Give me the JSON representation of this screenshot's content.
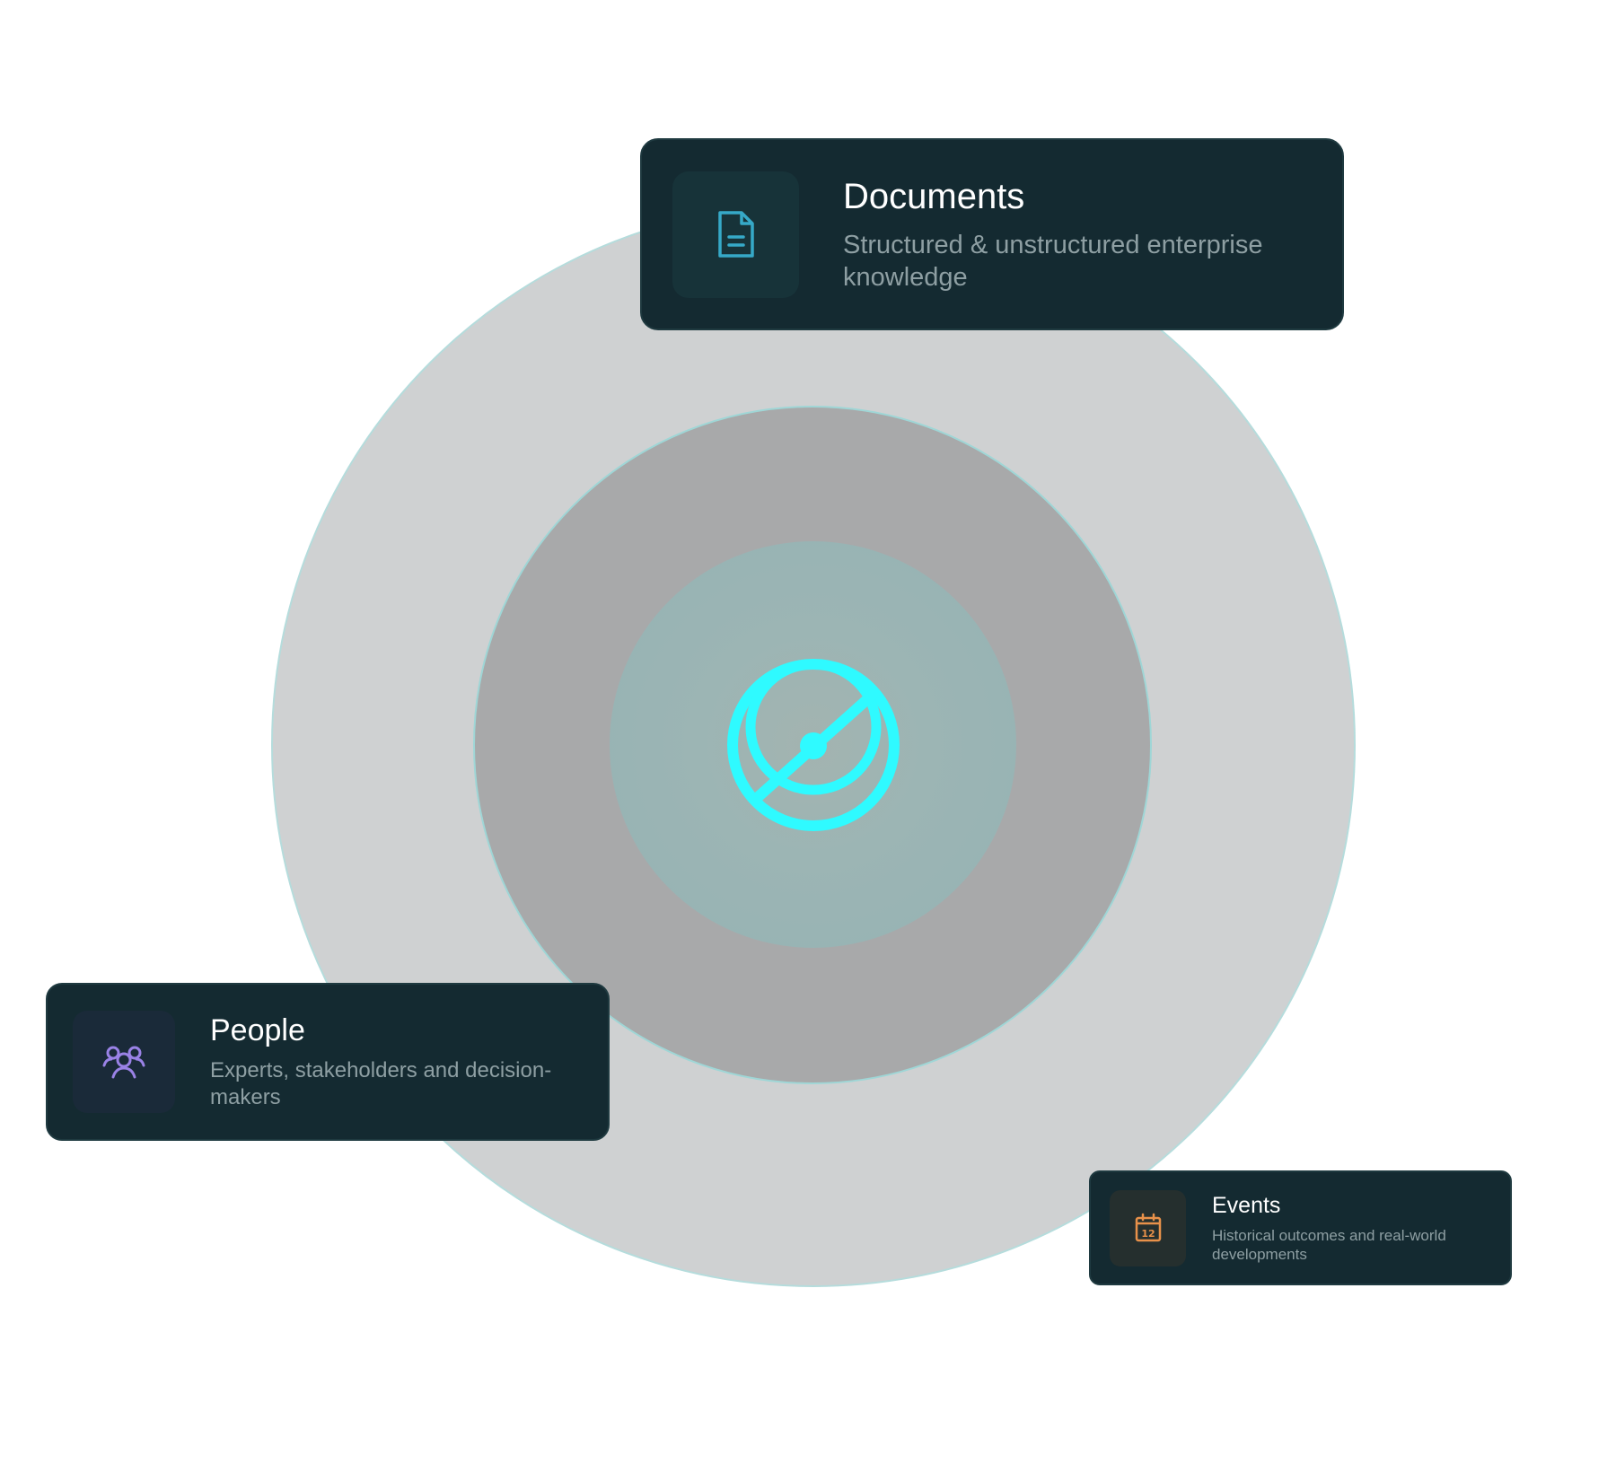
{
  "colors": {
    "accent": "#2ffaff",
    "card_bg": "#142a31",
    "documents_icon": "#36a9c8",
    "people_icon": "#9a82e6",
    "events_icon": "#e8914a"
  },
  "hub": {
    "icon": "compass-icon"
  },
  "cards": {
    "documents": {
      "icon": "document-icon",
      "title": "Documents",
      "description": "Structured & unstructured enterprise knowledge"
    },
    "people": {
      "icon": "people-icon",
      "title": "People",
      "description": "Experts, stakeholders and decision-makers"
    },
    "events": {
      "icon": "calendar-icon",
      "title": "Events",
      "description": "Historical outcomes and real-world developments",
      "icon_label": "12"
    }
  }
}
